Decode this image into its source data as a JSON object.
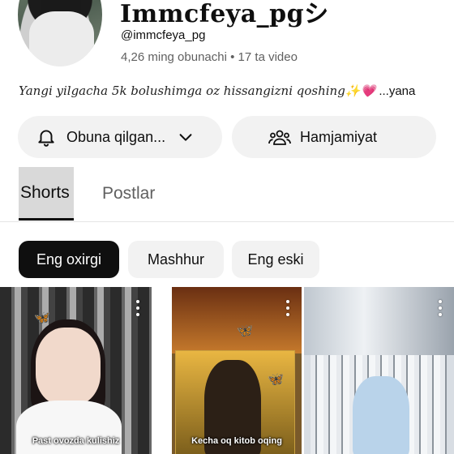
{
  "channel": {
    "title": "Immcfeya_pgシ",
    "handle": "@immcfeya_pg",
    "subscribers": "4,26 ming obunachi",
    "separator": "•",
    "video_count": "17 ta video",
    "description": "Yangi yilgacha 5k bolushimga oz hissangizni qoshing✨💗",
    "description_more": " ...yana"
  },
  "actions": {
    "subscribe_label": "Obuna qilgan...",
    "community_label": "Hamjamiyat"
  },
  "tabs": [
    {
      "label": "Shorts",
      "selected": true
    },
    {
      "label": "Postlar",
      "selected": false
    }
  ],
  "chips": [
    {
      "label": "Eng oxirgi",
      "selected": true
    },
    {
      "label": "Mashhur",
      "selected": false
    },
    {
      "label": "Eng eski",
      "selected": false
    }
  ],
  "shorts": [
    {
      "caption": "Past ovozda kulishiz"
    },
    {
      "caption": "Kecha oq kitob oqing"
    },
    {
      "caption": ""
    }
  ],
  "icons": {
    "avatar": "channel-avatar",
    "bell": "bell-icon",
    "chevron": "chevron-down-icon",
    "community": "people-icon",
    "more": "more-vertical-icon"
  },
  "colors": {
    "chip_selected_bg": "#0f0f0f",
    "pill_bg": "#f2f2f2",
    "secondary_text": "#606060"
  }
}
